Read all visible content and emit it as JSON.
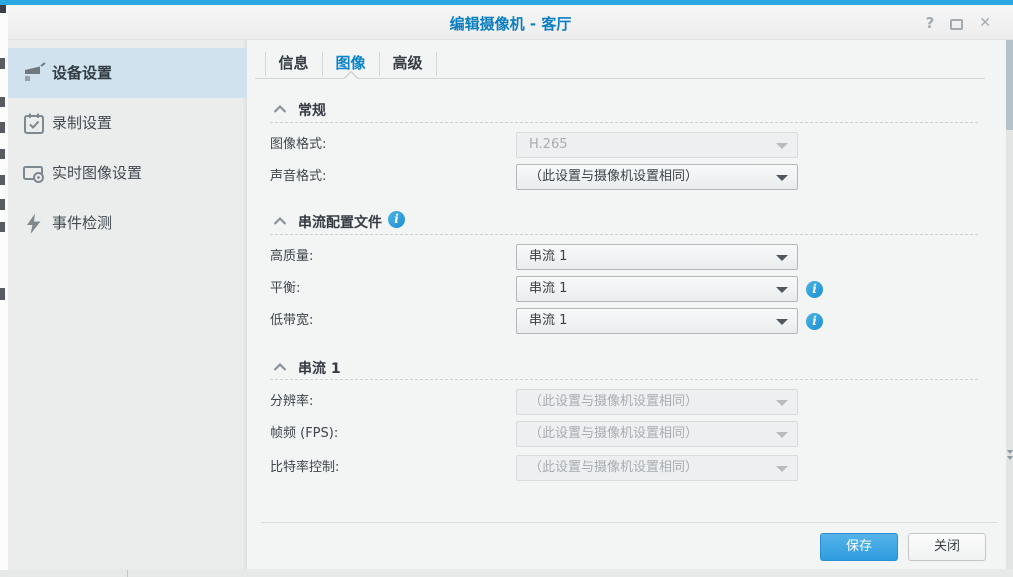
{
  "window": {
    "title": "编辑摄像机 - 客厅",
    "help_icon": "?",
    "close_icon": "✕"
  },
  "sidebar": {
    "items": [
      {
        "label": "设备设置",
        "icon": "device-settings-icon",
        "selected": true
      },
      {
        "label": "录制设置",
        "icon": "recording-settings-icon",
        "selected": false
      },
      {
        "label": "实时图像设置",
        "icon": "live-view-settings-icon",
        "selected": false
      },
      {
        "label": "事件检测",
        "icon": "event-detection-icon",
        "selected": false
      }
    ]
  },
  "tabs": [
    {
      "label": "信息",
      "selected": false
    },
    {
      "label": "图像",
      "selected": true
    },
    {
      "label": "高级",
      "selected": false
    }
  ],
  "sections": [
    {
      "title": "常规",
      "has_info": false,
      "rows": [
        {
          "label": "图像格式:",
          "value": "H.265",
          "disabled": true,
          "info": false
        },
        {
          "label": "声音格式:",
          "value": "（此设置与摄像机设置相同）",
          "disabled": false,
          "info": false
        }
      ]
    },
    {
      "title": "串流配置文件",
      "has_info": true,
      "rows": [
        {
          "label": "高质量:",
          "value": "串流 1",
          "disabled": false,
          "info": false
        },
        {
          "label": "平衡:",
          "value": "串流 1",
          "disabled": false,
          "info": true
        },
        {
          "label": "低带宽:",
          "value": "串流 1",
          "disabled": false,
          "info": true
        }
      ]
    },
    {
      "title": "串流 1",
      "has_info": false,
      "rows": [
        {
          "label": "分辨率:",
          "value": "（此设置与摄像机设置相同）",
          "disabled": true,
          "info": false
        },
        {
          "label": "帧频 (FPS):",
          "value": "（此设置与摄像机设置相同）",
          "disabled": true,
          "info": false
        },
        {
          "label": "比特率控制:",
          "value": "（此设置与摄像机设置相同）",
          "disabled": true,
          "info": false
        }
      ]
    }
  ],
  "info_badge": "i",
  "footer": {
    "save_label": "保存",
    "close_label": "关闭"
  },
  "colors": {
    "accent_blue": "#0c84c6",
    "topline_blue": "#2ba7e2",
    "save_button_blue": "#3aa4e4",
    "selected_item_bg": "#cfe2ed",
    "sidebar_bg": "#ebecec",
    "content_bg": "#f3f4f4",
    "info_icon_blue": "#2a9fd8"
  }
}
